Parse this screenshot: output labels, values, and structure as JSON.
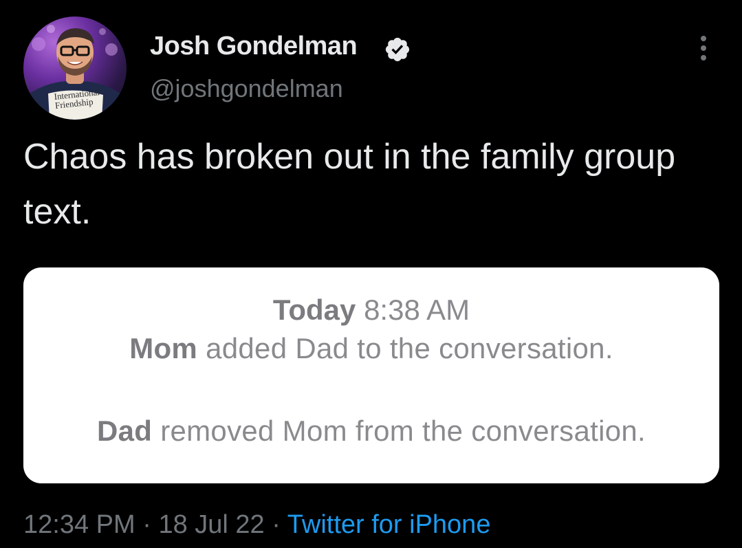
{
  "author": {
    "display_name": "Josh Gondelman",
    "handle": "@joshgondelman",
    "avatar_shirt_text": "International\nFriendship",
    "verified_color": "#e7e9ea"
  },
  "tweet": {
    "text": "Chaos has broken out in the family group text."
  },
  "media": {
    "timestamp_day": "Today",
    "timestamp_time": "8:38 AM",
    "message_1_actor": "Mom",
    "message_1_rest": "added Dad to the conversation.",
    "message_2_actor": "Dad",
    "message_2_rest": "removed Mom from the conversation."
  },
  "meta": {
    "time": "12:34 PM",
    "separator": "·",
    "date": "18 Jul 22",
    "source": "Twitter for iPhone",
    "source_color": "#1d9bf0"
  }
}
